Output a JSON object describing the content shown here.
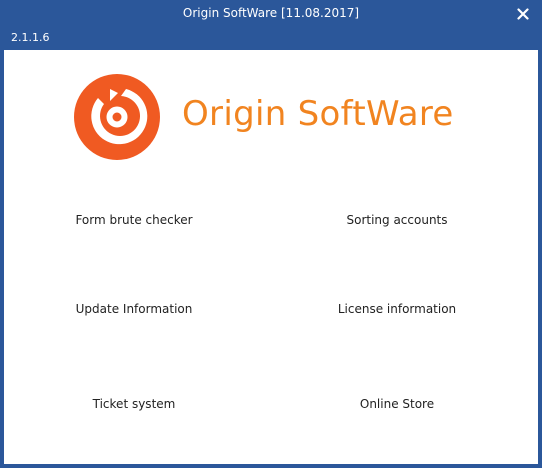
{
  "window": {
    "title": "Origin SoftWare [11.08.2017]",
    "close_glyph": "✕",
    "close_icon": "close-icon",
    "version": "2.1.1.6"
  },
  "logo": {
    "icon": "origin-logo-icon",
    "text": "Origin SoftWare",
    "brand_color": "#f18420",
    "accent_color": "#f05a22"
  },
  "colors": {
    "titlebar": "#2b579a",
    "content_bg": "#ffffff",
    "link_text": "#222222"
  },
  "menu": {
    "form_brute_checker": "Form brute checker",
    "sorting_accounts": "Sorting accounts",
    "update_information": "Update Information",
    "license_information": "License information",
    "ticket_system": "Ticket system",
    "online_store": "Online Store"
  }
}
